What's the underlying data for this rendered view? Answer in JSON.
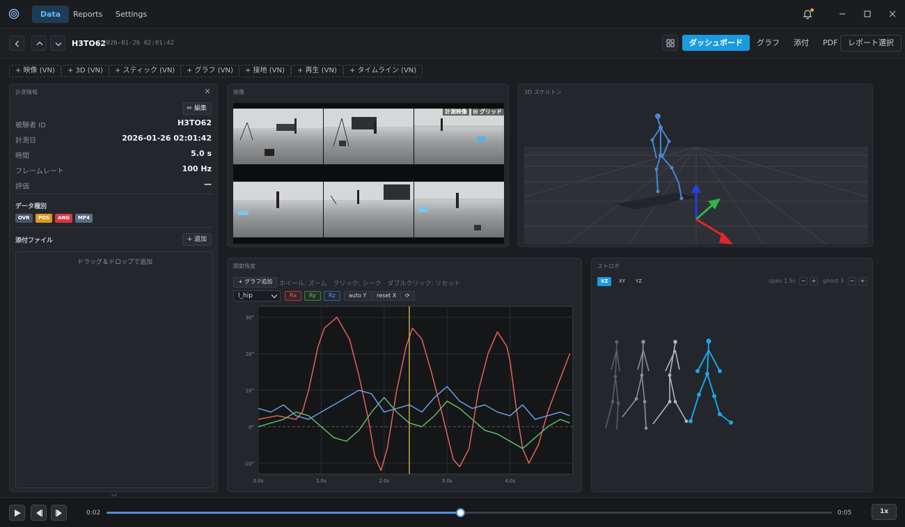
{
  "nav": {
    "tabs": [
      "Data",
      "Reports",
      "Settings"
    ],
    "active": "Data"
  },
  "window": {
    "notification_dot_color": "#e8a33c"
  },
  "toolbar": {
    "subject_id": "H3TO62",
    "timestamp": "2026-01-26 02:01:42",
    "view_tabs": [
      "ダッシュボード",
      "グラフ",
      "添付",
      "PDF"
    ],
    "active_view": "ダッシュボード",
    "report_select": "レポート選択"
  },
  "add_panels": [
    "+ 映像 (VN)",
    "+ 3D (VN)",
    "+ スティック (VN)",
    "+ グラフ (VN)",
    "+ 接地 (VN)",
    "+ 再生 (VN)",
    "+ タイムライン (VN)"
  ],
  "info": {
    "title": "計測情報",
    "edit_label": "✏ 編集",
    "rows": [
      {
        "label": "被験者 ID",
        "value": "H3TO62"
      },
      {
        "label": "計測日",
        "value": "2026-01-26 02:01:42"
      },
      {
        "label": "時間",
        "value": "5.0 s"
      },
      {
        "label": "フレームレート",
        "value": "100 Hz"
      },
      {
        "label": "評価",
        "value": "—"
      }
    ],
    "data_type_label": "データ種別",
    "data_types": [
      {
        "label": "OVR",
        "color": "#4a5568"
      },
      {
        "label": "POS",
        "color": "#d99a1e"
      },
      {
        "label": "ANG",
        "color": "#d9363e"
      },
      {
        "label": "MP4",
        "color": "#5d6b82"
      }
    ],
    "attach_label": "添付ファイル",
    "add_label": "+ 追加",
    "dropzone_text": "ドラッグ＆ドロップで追加"
  },
  "video": {
    "title": "映像",
    "overlay_a": "計測映像",
    "overlay_b": "⊞ グリッド"
  },
  "skeleton": {
    "title": "3D スケルトン"
  },
  "chart_panel": {
    "title": "関節角度",
    "add_graph": "+ グラフ追加",
    "hint": "ホイール: ズーム　クリック: シーク　ダブルクリック: リセット",
    "joint": "l_hip",
    "buttons": {
      "rx": "Rx",
      "ry": "Ry",
      "rz": "Rz",
      "auto_y": "auto Y",
      "reset_x": "reset X",
      "refresh": "⟳"
    }
  },
  "chart_data": {
    "type": "line",
    "xlim": [
      0,
      5
    ],
    "ylim": [
      -13,
      33
    ],
    "x_ticks": [
      "0.0s",
      "1.0s",
      "2.0s",
      "3.0s",
      "4.0s"
    ],
    "y_ticks": [
      "30°",
      "20°",
      "10°",
      "0°",
      "-10°"
    ],
    "cursor_x": 2.4,
    "series": [
      {
        "name": "Rx",
        "color": "#e8605c",
        "x": [
          0,
          0.3,
          0.6,
          0.7,
          0.8,
          0.95,
          1.05,
          1.25,
          1.45,
          1.6,
          1.75,
          1.85,
          1.95,
          2.05,
          2.2,
          2.35,
          2.45,
          2.6,
          2.75,
          2.9,
          3.0,
          3.1,
          3.2,
          3.35,
          3.5,
          3.65,
          3.8,
          3.95,
          4.0,
          4.1,
          4.2,
          4.3,
          4.45,
          4.6,
          4.75,
          4.95
        ],
        "y": [
          2,
          3,
          2,
          4,
          10,
          22,
          27,
          30,
          24,
          14,
          2,
          -8,
          -12,
          -6,
          10,
          22,
          27,
          24,
          15,
          5,
          -2,
          -9,
          -11,
          -6,
          10,
          20,
          26,
          22,
          18,
          5,
          -6,
          -10,
          -5,
          4,
          11,
          20
        ]
      },
      {
        "name": "Ry",
        "color": "#5cbd6a",
        "x": [
          0,
          0.2,
          0.4,
          0.6,
          0.8,
          1.0,
          1.2,
          1.4,
          1.6,
          1.8,
          2.0,
          2.2,
          2.4,
          2.6,
          2.8,
          3.0,
          3.2,
          3.4,
          3.6,
          3.8,
          4.0,
          4.2,
          4.4,
          4.6,
          4.8,
          4.95
        ],
        "y": [
          0,
          1,
          2,
          4,
          3,
          0,
          -3,
          -4,
          -1,
          4,
          8,
          4,
          1,
          0,
          3,
          7,
          5,
          2,
          -1,
          -2,
          -4,
          -6,
          -3,
          0,
          2,
          1
        ]
      },
      {
        "name": "Rz",
        "color": "#6a9fe8",
        "x": [
          0,
          0.2,
          0.4,
          0.6,
          0.8,
          1.0,
          1.2,
          1.4,
          1.6,
          1.8,
          2.0,
          2.2,
          2.4,
          2.6,
          2.8,
          3.0,
          3.2,
          3.4,
          3.6,
          3.8,
          4.0,
          4.2,
          4.4,
          4.6,
          4.8,
          4.95
        ],
        "y": [
          5,
          4,
          6,
          3,
          2,
          4,
          6,
          8,
          10,
          9,
          4,
          5,
          6,
          4,
          8,
          11,
          7,
          5,
          6,
          4,
          3,
          6,
          2,
          3,
          4,
          3
        ]
      }
    ]
  },
  "strobo": {
    "title": "ストロボ",
    "planes": [
      "XZ",
      "XY",
      "YZ"
    ],
    "active_plane": "XZ",
    "span_label": "span 1.5s",
    "ghost_label": "ghost 3",
    "minus": "−",
    "plus": "+"
  },
  "playback": {
    "current": "0:02",
    "end": "0:05",
    "progress": 0.488,
    "speed": "1x"
  }
}
